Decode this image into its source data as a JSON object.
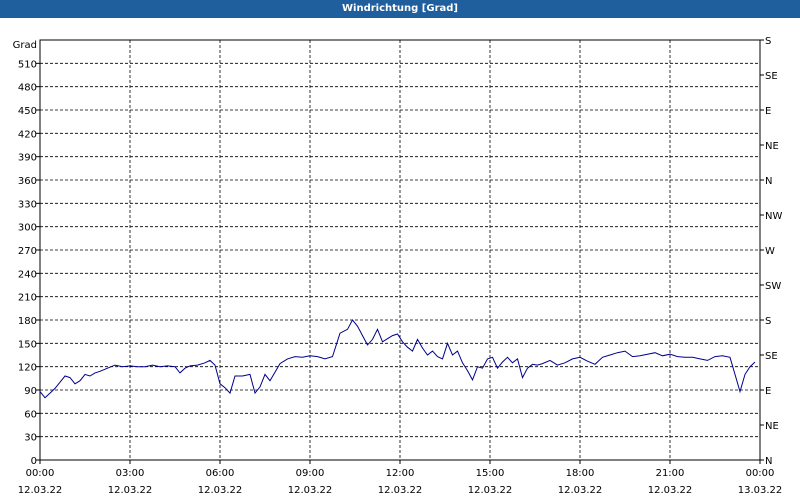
{
  "window": {
    "title": "Windrichtung [Grad]"
  },
  "chart_data": {
    "type": "line",
    "title": "Windrichtung [Grad]",
    "ylabel": "Grad",
    "ylim": [
      0,
      540
    ],
    "yticks": [
      0,
      30,
      60,
      90,
      120,
      150,
      180,
      210,
      240,
      270,
      300,
      330,
      360,
      390,
      420,
      450,
      480,
      510
    ],
    "right_axis_ticks": [
      {
        "value": 0,
        "label": "N"
      },
      {
        "value": 45,
        "label": "NE"
      },
      {
        "value": 90,
        "label": "E"
      },
      {
        "value": 135,
        "label": "SE"
      },
      {
        "value": 180,
        "label": "S"
      },
      {
        "value": 225,
        "label": "SW"
      },
      {
        "value": 270,
        "label": "W"
      },
      {
        "value": 315,
        "label": "NW"
      },
      {
        "value": 360,
        "label": "N"
      },
      {
        "value": 405,
        "label": "NE"
      },
      {
        "value": 450,
        "label": "E"
      },
      {
        "value": 495,
        "label": "SE"
      },
      {
        "value": 540,
        "label": "S"
      }
    ],
    "xlim": [
      "2022-03-12 00:00",
      "2022-03-13 00:00"
    ],
    "xticks": [
      {
        "time": "00:00",
        "date": "12.03.22"
      },
      {
        "time": "03:00",
        "date": "12.03.22"
      },
      {
        "time": "06:00",
        "date": "12.03.22"
      },
      {
        "time": "09:00",
        "date": "12.03.22"
      },
      {
        "time": "12:00",
        "date": "12.03.22"
      },
      {
        "time": "15:00",
        "date": "12.03.22"
      },
      {
        "time": "18:00",
        "date": "12.03.22"
      },
      {
        "time": "21:00",
        "date": "12.03.22"
      },
      {
        "time": "00:00",
        "date": "13.03.22"
      }
    ],
    "grid": true,
    "line_color": "#00008b",
    "series": [
      {
        "x": [
          "2022-03-12 00:00",
          "2022-03-12 00:10",
          "2022-03-12 00:20",
          "2022-03-12 00:30",
          "2022-03-12 00:40",
          "2022-03-12 00:50",
          "2022-03-12 01:00",
          "2022-03-12 01:10",
          "2022-03-12 01:20",
          "2022-03-12 01:30",
          "2022-03-12 01:40",
          "2022-03-12 01:50",
          "2022-03-12 02:00",
          "2022-03-12 02:15",
          "2022-03-12 02:30",
          "2022-03-12 02:45",
          "2022-03-12 03:00",
          "2022-03-12 03:15",
          "2022-03-12 03:30",
          "2022-03-12 03:45",
          "2022-03-12 04:00",
          "2022-03-12 04:15",
          "2022-03-12 04:30",
          "2022-03-12 04:40",
          "2022-03-12 04:50",
          "2022-03-12 05:00",
          "2022-03-12 05:15",
          "2022-03-12 05:30",
          "2022-03-12 05:40",
          "2022-03-12 05:50",
          "2022-03-12 06:00",
          "2022-03-12 06:10",
          "2022-03-12 06:20",
          "2022-03-12 06:30",
          "2022-03-12 06:45",
          "2022-03-12 07:00",
          "2022-03-12 07:10",
          "2022-03-12 07:20",
          "2022-03-12 07:30",
          "2022-03-12 07:40",
          "2022-03-12 08:00",
          "2022-03-12 08:15",
          "2022-03-12 08:30",
          "2022-03-12 08:45",
          "2022-03-12 09:00",
          "2022-03-12 09:15",
          "2022-03-12 09:30",
          "2022-03-12 09:45",
          "2022-03-12 10:00",
          "2022-03-12 10:15",
          "2022-03-12 10:25",
          "2022-03-12 10:35",
          "2022-03-12 10:45",
          "2022-03-12 10:55",
          "2022-03-12 11:05",
          "2022-03-12 11:15",
          "2022-03-12 11:25",
          "2022-03-12 11:35",
          "2022-03-12 11:45",
          "2022-03-12 11:55",
          "2022-03-12 12:05",
          "2022-03-12 12:15",
          "2022-03-12 12:25",
          "2022-03-12 12:35",
          "2022-03-12 12:45",
          "2022-03-12 12:55",
          "2022-03-12 13:05",
          "2022-03-12 13:15",
          "2022-03-12 13:25",
          "2022-03-12 13:35",
          "2022-03-12 13:45",
          "2022-03-12 13:55",
          "2022-03-12 14:05",
          "2022-03-12 14:15",
          "2022-03-12 14:25",
          "2022-03-12 14:35",
          "2022-03-12 14:45",
          "2022-03-12 14:55",
          "2022-03-12 15:05",
          "2022-03-12 15:15",
          "2022-03-12 15:25",
          "2022-03-12 15:35",
          "2022-03-12 15:45",
          "2022-03-12 15:55",
          "2022-03-12 16:05",
          "2022-03-12 16:15",
          "2022-03-12 16:25",
          "2022-03-12 16:35",
          "2022-03-12 16:45",
          "2022-03-12 17:00",
          "2022-03-12 17:15",
          "2022-03-12 17:30",
          "2022-03-12 17:45",
          "2022-03-12 18:00",
          "2022-03-12 18:15",
          "2022-03-12 18:30",
          "2022-03-12 18:45",
          "2022-03-12 19:00",
          "2022-03-12 19:15",
          "2022-03-12 19:30",
          "2022-03-12 19:45",
          "2022-03-12 20:00",
          "2022-03-12 20:15",
          "2022-03-12 20:30",
          "2022-03-12 20:45",
          "2022-03-12 21:00",
          "2022-03-12 21:15",
          "2022-03-12 21:30",
          "2022-03-12 21:45",
          "2022-03-12 22:00",
          "2022-03-12 22:15",
          "2022-03-12 22:30",
          "2022-03-12 22:45",
          "2022-03-12 23:00",
          "2022-03-12 23:10",
          "2022-03-12 23:20",
          "2022-03-12 23:30",
          "2022-03-12 23:40",
          "2022-03-12 23:50"
        ],
        "y": [
          88,
          80,
          86,
          92,
          100,
          108,
          106,
          98,
          102,
          110,
          108,
          112,
          114,
          118,
          122,
          120,
          121,
          120,
          120,
          122,
          120,
          121,
          120,
          112,
          118,
          121,
          122,
          125,
          128,
          122,
          98,
          93,
          86,
          108,
          108,
          110,
          86,
          94,
          110,
          102,
          124,
          130,
          133,
          132,
          134,
          133,
          130,
          133,
          163,
          168,
          180,
          172,
          160,
          148,
          155,
          168,
          152,
          156,
          160,
          162,
          152,
          145,
          140,
          155,
          144,
          135,
          140,
          133,
          130,
          150,
          135,
          140,
          125,
          115,
          103,
          120,
          118,
          130,
          132,
          118,
          126,
          132,
          125,
          130,
          106,
          118,
          123,
          122,
          124,
          128,
          122,
          125,
          130,
          132,
          127,
          123,
          132,
          135,
          138,
          140,
          133,
          134,
          136,
          138,
          134,
          136,
          133,
          132,
          132,
          130,
          128,
          133,
          134,
          132,
          110,
          88,
          110,
          120,
          126
        ]
      }
    ]
  }
}
